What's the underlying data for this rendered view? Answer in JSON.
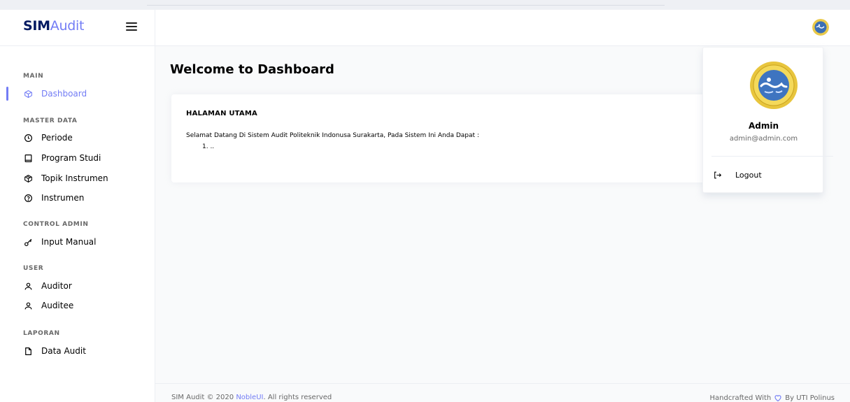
{
  "brand": {
    "strong": "SIM",
    "light": "Audit"
  },
  "sidebar": {
    "categories": {
      "main": "MAIN",
      "master": "MASTER DATA",
      "control": "CONTROL ADMIN",
      "user": "USER",
      "laporan": "LAPORAN"
    },
    "items": {
      "dashboard": "Dashboard",
      "periode": "Periode",
      "program_studi": "Program Studi",
      "topik_instrumen": "Topik Instrumen",
      "instrumen": "Instrumen",
      "input_manual": "Input Manual",
      "auditor": "Auditor",
      "auditee": "Auditee",
      "data_audit": "Data Audit"
    },
    "active_item": "dashboard"
  },
  "main": {
    "title": "Welcome to Dashboard",
    "card": {
      "heading": "HALAMAN UTAMA",
      "text": "Selamat Datang Di Sistem Audit Politeknik Indonusa Surakarta, Pada Sistem Ini Anda Dapat :",
      "list_item": "1. .."
    }
  },
  "profile_dropdown": {
    "name": "Admin",
    "email": "admin@admin.com",
    "logout_label": "Logout"
  },
  "footer": {
    "copyright_prefix": "SIM Audit © 2020 ",
    "link_text": "NobleUI",
    "copyright_suffix": ". All rights reserved",
    "right_prefix": "Handcrafted With",
    "right_suffix": "By UTI Polinus"
  },
  "colors": {
    "accent": "#727cf5",
    "brand_dark": "#031a61",
    "text_muted": "#686868"
  },
  "icons": {
    "dashboard": "box-icon",
    "periode": "clock-icon",
    "program_studi": "square-icon",
    "topik_instrumen": "package-icon",
    "instrumen": "help-circle-icon",
    "input_manual": "key-icon",
    "auditor": "user-icon",
    "auditee": "user-icon",
    "data_audit": "file-icon",
    "logout": "log-out-icon",
    "footer": "heart-icon"
  }
}
